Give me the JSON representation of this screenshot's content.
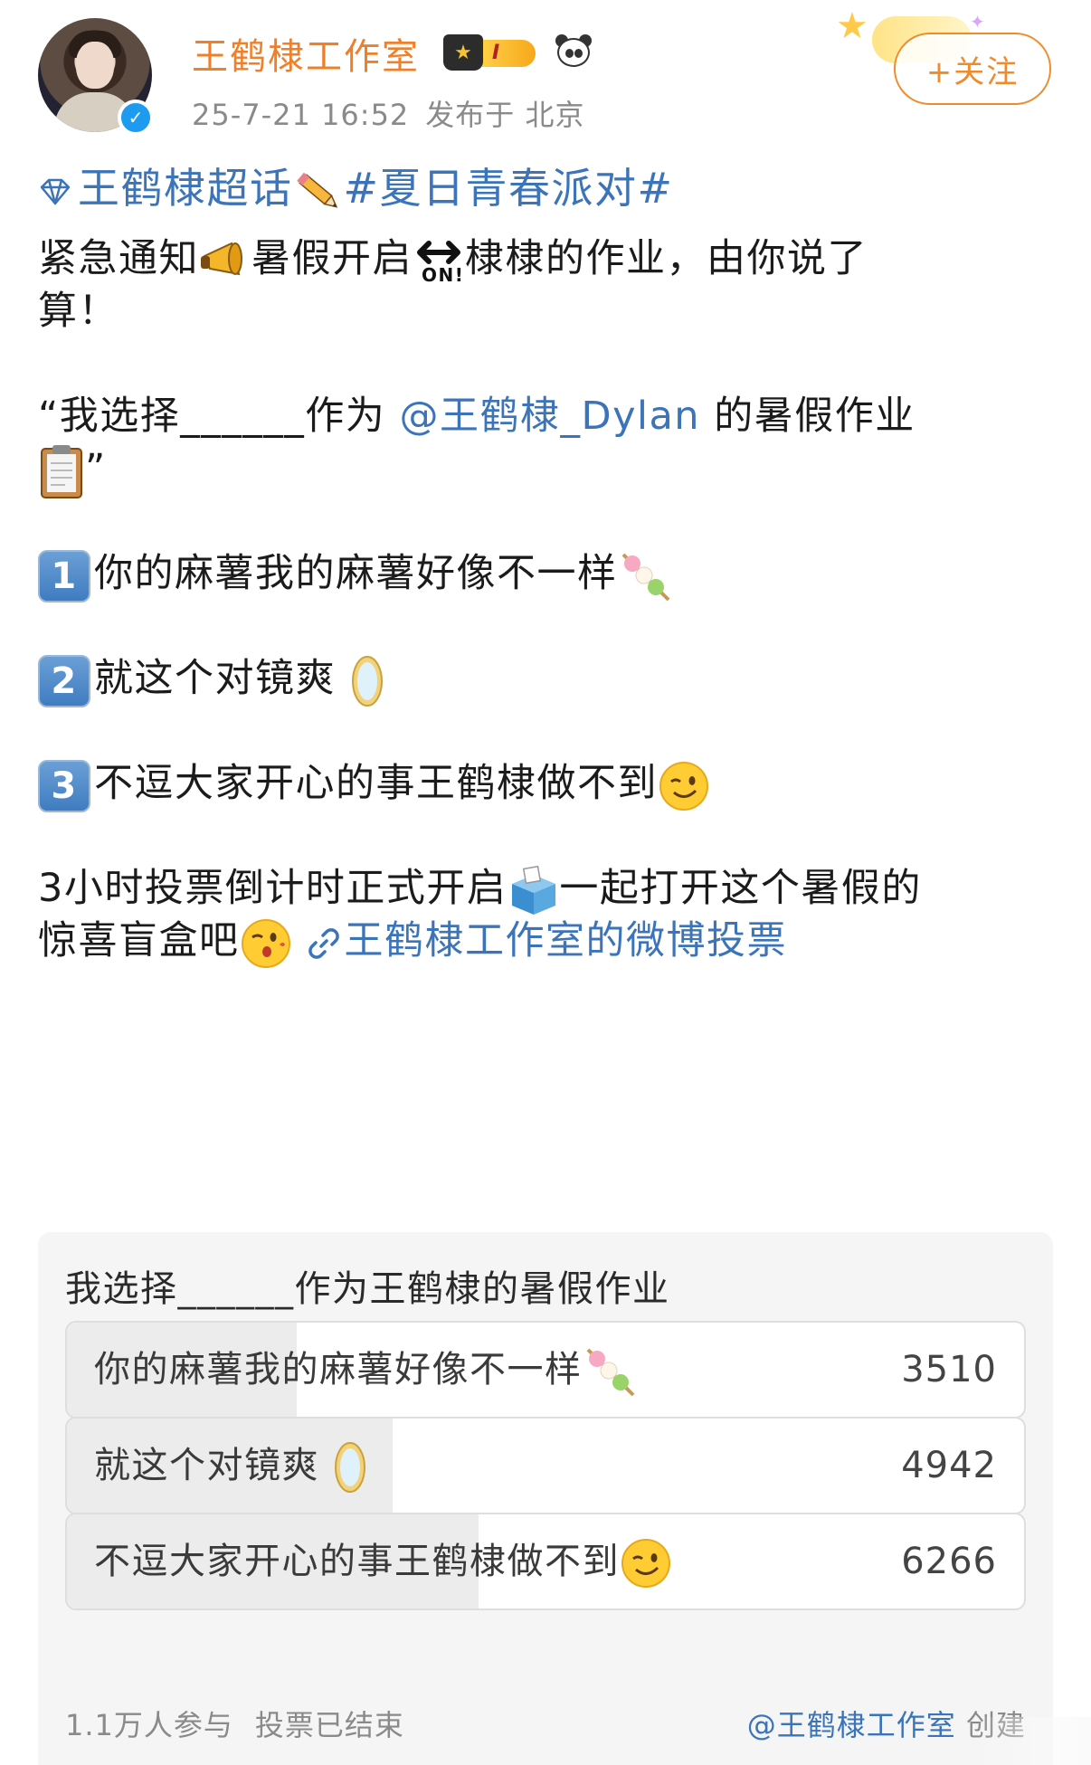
{
  "header": {
    "username": "王鹤棣工作室",
    "badge_level": "I",
    "timestamp": "25-7-21 16:52",
    "location": "发布于 北京",
    "follow_label": "+关注"
  },
  "post": {
    "supertopic": "王鹤棣超话",
    "hashtag": "#夏日青春派对#",
    "line1_a": "紧急通知",
    "line1_b": "暑假开启",
    "line1_c": "棣棣的作业，由你说了",
    "line1_d": "算！",
    "line2_a": "“我选择______作为",
    "line2_mention": "@王鹤棣_Dylan",
    "line2_b": "的暑假作业",
    "line2_c": "”",
    "option1_num": "1",
    "option1_text": "你的麻薯我的麻薯好像不一样",
    "option2_num": "2",
    "option2_text": "就这个对镜爽",
    "option3_num": "3",
    "option3_text": "不逗大家开心的事王鹤棣做不到",
    "line3_a": "3小时投票倒计时正式开启",
    "line3_b": "一起打开这个暑假的",
    "line4_a": "惊喜盲盒吧",
    "line4_link": "王鹤棣工作室的微博投票"
  },
  "poll": {
    "question": "我选择______作为王鹤棣的暑假作业",
    "options": [
      {
        "label": "你的麻薯我的麻薯好像不一样",
        "count": "3510",
        "share": 0.24
      },
      {
        "label": "就这个对镜爽",
        "count": "4942",
        "share": 0.34
      },
      {
        "label": "不逗大家开心的事王鹤棣做不到",
        "count": "6266",
        "share": 0.43
      }
    ],
    "participants": "1.1万人参与",
    "status": "投票已结束",
    "creator": "@王鹤棣工作室",
    "creator_suffix": "创建"
  },
  "colors": {
    "username": "#f07f2a",
    "link": "#3b74b8",
    "follow": "#f08a2a",
    "muted": "#8a8a8a"
  },
  "icons": [
    "verified-icon",
    "crown-badge-icon",
    "panda-icon",
    "super-topic-badge",
    "diamond-icon",
    "pencil-icon",
    "megaphone-icon",
    "on-arrow-icon",
    "clipboard-icon",
    "keycap-1-icon",
    "keycap-2-icon",
    "keycap-3-icon",
    "dango-icon",
    "mirror-icon",
    "winking-face-icon",
    "ballot-box-icon",
    "kissing-face-icon",
    "link-icon"
  ]
}
